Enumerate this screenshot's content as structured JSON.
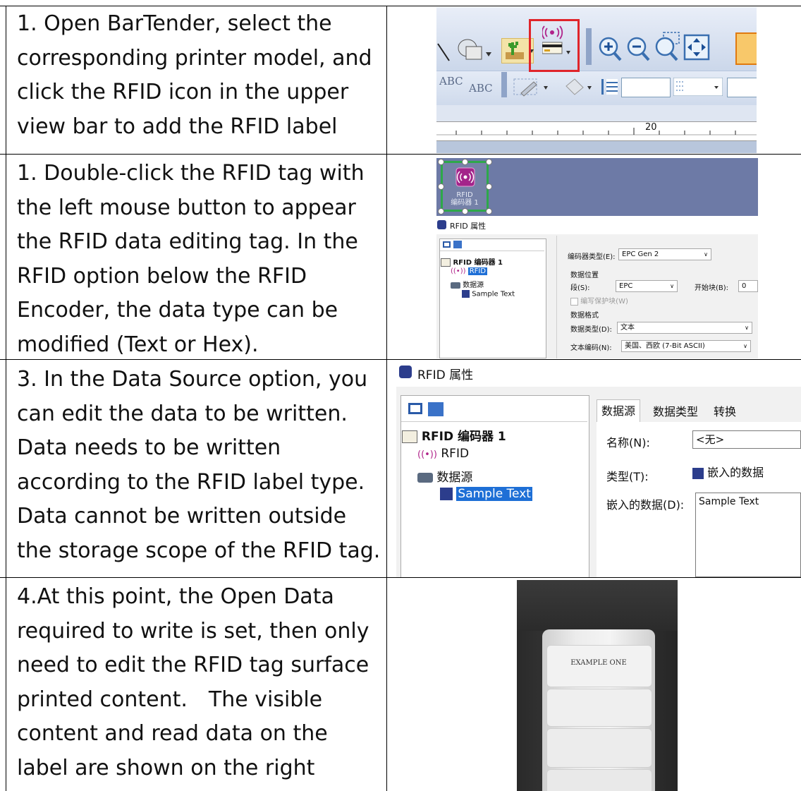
{
  "rows": [
    {
      "text": "1.  Open BarTender, select the corresponding printer model, and click the RFID icon in the upper view bar to add the RFID label"
    },
    {
      "text": "1.  Double-click the RFID tag with the left mouse button to appear the RFID data editing tag. In the RFID option below the RFID Encoder, the data type can be modified (Text or Hex)."
    },
    {
      "lines": [
        "3. In the Data Source option, you can edit the data to be written.",
        "Data needs to be written according to the RFID label type.",
        "Data cannot be written outside the storage scope of the RFID tag."
      ]
    },
    {
      "text": "4.At this point, the Open Data required to write is set, then only need to edit the RFID tag surface printed content.　The visible content and read data on the label are shown on the right"
    }
  ],
  "shot1": {
    "text_abc1": "ABC",
    "text_abc2": "ABC",
    "ruler_value": "20"
  },
  "shot2": {
    "object_label": "RFID",
    "object_sublabel": "编码器 1",
    "dialog_title": "RFID 属性",
    "tree": {
      "root": "RFID 编码器 1",
      "rfid": "RFID",
      "datasource": "数据源",
      "sample": "Sample Text"
    },
    "encoder_type_label": "编码器类型(E):",
    "encoder_type_value": "EPC Gen 2",
    "data_location_label": "数据位置",
    "segment_label": "段(S):",
    "segment_value": "EPC",
    "start_block_label": "开始块(B):",
    "start_block_value": "0",
    "write_protect_label": "编写保护块(W)",
    "data_format_label": "数据格式",
    "data_type_label": "数据类型(D):",
    "data_type_value": "文本",
    "text_encoding_label": "文本编码(N):",
    "text_encoding_value": "美国、西欧 (7-Bit ASCII)"
  },
  "shot3": {
    "dialog_title": "RFID 属性",
    "tree": {
      "root": "RFID 编码器 1",
      "rfid": "RFID",
      "datasource": "数据源",
      "sample": "Sample Text"
    },
    "tabs": [
      "数据源",
      "数据类型",
      "转换"
    ],
    "name_label": "名称(N):",
    "name_value": "<无>",
    "type_label": "类型(T):",
    "type_value": "嵌入的数据",
    "embedded_label": "嵌入的数据(D):",
    "embedded_value": "Sample Text"
  },
  "shot4": {
    "label_text": "EXAMPLE ONE"
  }
}
